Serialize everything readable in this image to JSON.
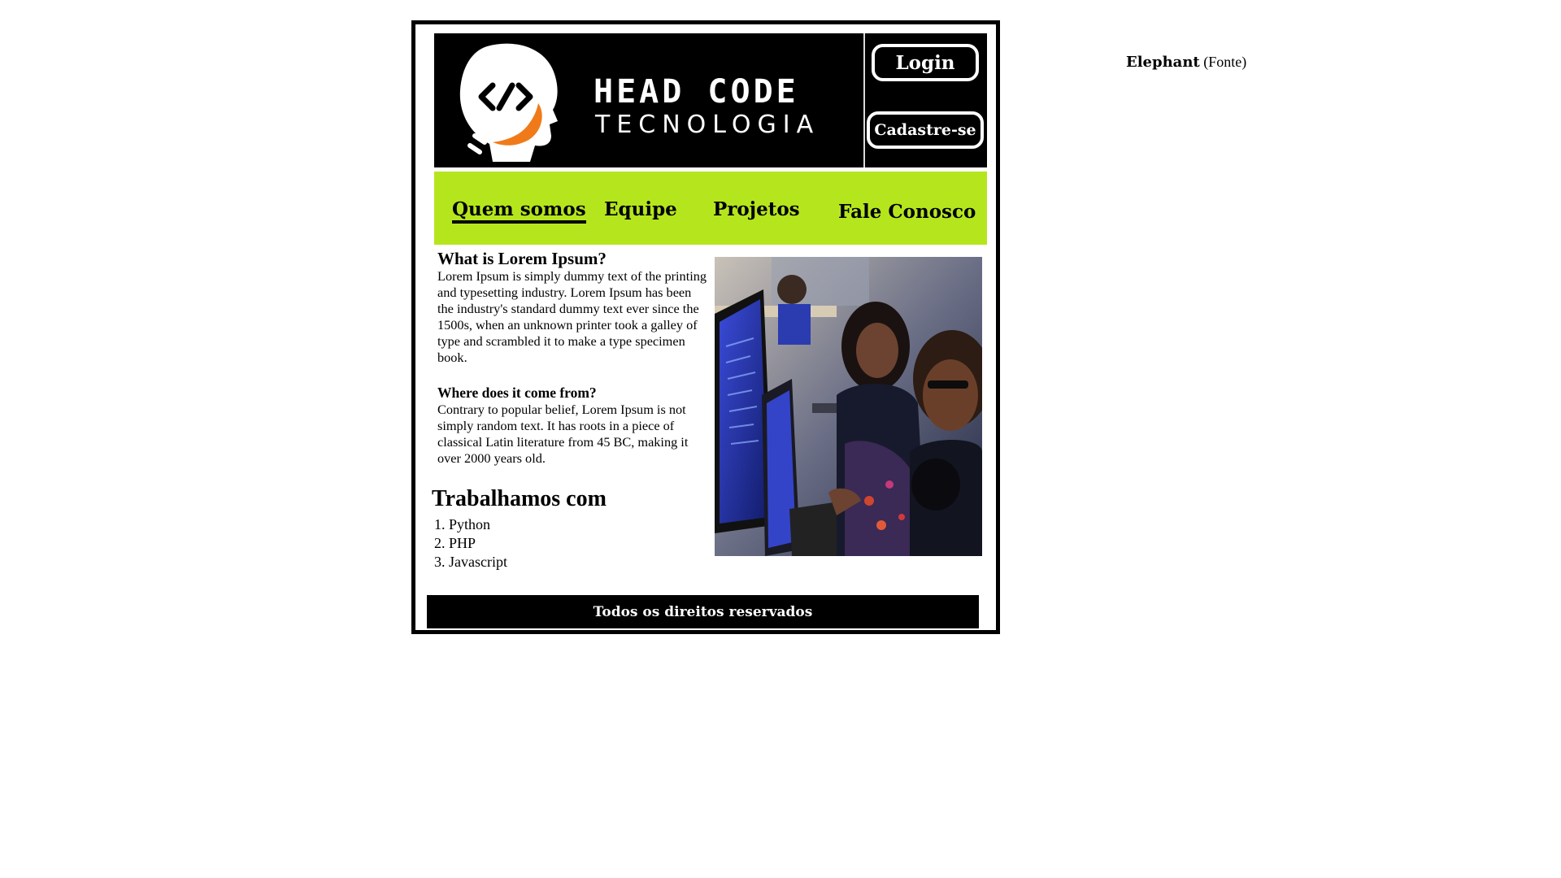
{
  "header": {
    "brand_line1": "HEAD CODE",
    "brand_line2": "TECNOLOGIA",
    "login_label": "Login",
    "signup_label": "Cadastre-se"
  },
  "nav": {
    "items": [
      {
        "label": "Quem somos",
        "active": true
      },
      {
        "label": "Equipe"
      },
      {
        "label": "Projetos"
      },
      {
        "label": "Fale Conosco"
      }
    ]
  },
  "content": {
    "heading1": "What is Lorem Ipsum?",
    "paragraph1": "Lorem Ipsum is simply dummy text of the printing and typesetting industry. Lorem Ipsum has been the industry's standard dummy text ever since the 1500s, when an unknown printer took a galley of type and scrambled it to make a type specimen book.",
    "heading2": "Where does it come from?",
    "paragraph2": "Contrary to popular belief, Lorem Ipsum is not simply random text. It has roots in a piece of classical Latin literature from 45 BC, making it over 2000 years old.",
    "section_title": "Trabalhamos com",
    "languages": [
      "1. Python",
      "2. PHP",
      "3. Javascript"
    ]
  },
  "footer": {
    "text": "Todos os direitos reservados"
  },
  "credit": {
    "font_name": "Elephant",
    "suffix": "(Fonte)"
  },
  "colors": {
    "nav_background": "#b5e61d",
    "header_background": "#000000",
    "logo_accent": "#f07a1a"
  }
}
